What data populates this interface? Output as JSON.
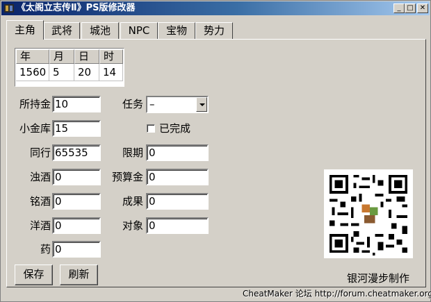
{
  "window": {
    "title": "《太阁立志传Ⅱ》PS版修改器",
    "caption_buttons": {
      "minimize": "_",
      "maximize": "□",
      "close": "✕"
    }
  },
  "tabs": [
    {
      "label": "主角",
      "active": true
    },
    {
      "label": "武将"
    },
    {
      "label": "城池"
    },
    {
      "label": "NPC"
    },
    {
      "label": "宝物"
    },
    {
      "label": "势力"
    }
  ],
  "date_table": {
    "headers": [
      "年",
      "月",
      "日",
      "时"
    ],
    "values": [
      "1560",
      "5",
      "20",
      "14"
    ]
  },
  "fields": {
    "money": {
      "label": "所持金",
      "value": "10"
    },
    "vault": {
      "label": "小金库",
      "value": "15"
    },
    "peer": {
      "label": "同行",
      "value": "65535"
    },
    "sake_turbid": {
      "label": "浊酒",
      "value": "0"
    },
    "sake_fine": {
      "label": "铭酒",
      "value": "0"
    },
    "wine": {
      "label": "洋酒",
      "value": "0"
    },
    "medicine": {
      "label": "药",
      "value": "0"
    }
  },
  "mission": {
    "label": "任务",
    "selected": "–",
    "completed_label": "已完成",
    "deadline": {
      "label": "限期",
      "value": "0"
    },
    "budget": {
      "label": "预算金",
      "value": "0"
    },
    "result": {
      "label": "成果",
      "value": "0"
    },
    "target": {
      "label": "对象",
      "value": "0"
    }
  },
  "buttons": {
    "save": "保存",
    "refresh": "刷新"
  },
  "credit": "银河漫步制作",
  "footer": "CheatMaker 论坛 http://forum.cheatmaker.org/",
  "icons": {
    "app": "app-icon",
    "qr": "qr-code-icon"
  },
  "colors": {
    "face": "#d4d0c8",
    "title_start": "#0a246a",
    "title_end": "#a6caf0"
  }
}
